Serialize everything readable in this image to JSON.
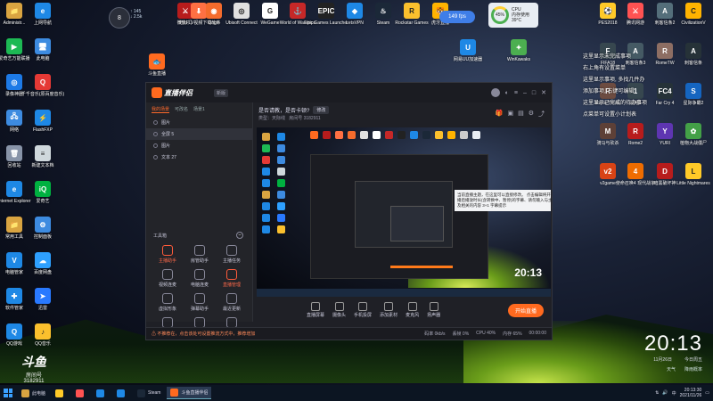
{
  "desktop": {
    "left_icons": [
      {
        "label": "Administr...",
        "color": "#d9a441",
        "glyph": "📁"
      },
      {
        "label": "上网导航",
        "color": "#1e88e5",
        "glyph": "e"
      },
      {
        "label": "爱奇艺万能联播",
        "color": "#1db954",
        "glyph": "▶"
      },
      {
        "label": "此电脑",
        "color": "#3d8be0",
        "glyph": "🖥"
      },
      {
        "label": "录像神器",
        "color": "#1d7ae6",
        "glyph": "◎"
      },
      {
        "label": "千千音乐(原百度音乐)",
        "color": "#e53935",
        "glyph": "Q"
      },
      {
        "label": "网络",
        "color": "#3d8be0",
        "glyph": "🖧"
      },
      {
        "label": "FlashFXP",
        "color": "#1e88e5",
        "glyph": "⚡"
      },
      {
        "label": "回收站",
        "color": "#8894a8",
        "glyph": "🗑"
      },
      {
        "label": "新建文本档",
        "color": "#cfd8dc",
        "glyph": "≡"
      },
      {
        "label": "Internet Explorer",
        "color": "#1e88e5",
        "glyph": "e"
      },
      {
        "label": "爱奇艺",
        "color": "#00b140",
        "glyph": "iQ"
      },
      {
        "label": "常用工具",
        "color": "#d9a441",
        "glyph": "📁"
      },
      {
        "label": "控制面板",
        "color": "#3d8be0",
        "glyph": "⚙"
      },
      {
        "label": "电脑管家",
        "color": "#1e88e5",
        "glyph": "V"
      },
      {
        "label": "百度网盘",
        "color": "#2ea0ff",
        "glyph": "☁"
      },
      {
        "label": "软件管家",
        "color": "#1e88e5",
        "glyph": "✚"
      },
      {
        "label": "迅雷",
        "color": "#2979ff",
        "glyph": "➤"
      },
      {
        "label": "QQ游戏",
        "color": "#1e88e5",
        "glyph": "Q"
      },
      {
        "label": "QQ音乐",
        "color": "#fbc02d",
        "glyph": "♪"
      }
    ],
    "top_icons": [
      {
        "label": "斗鱼直播",
        "color": "#ff6a1f",
        "glyph": "🐟"
      },
      {
        "label": "地狱门",
        "color": "#b71c1c",
        "glyph": "⚔"
      },
      {
        "label": "微软FLV视频下载软件",
        "color": "#ff7043",
        "glyph": "⬇"
      },
      {
        "label": "Origin",
        "color": "#f56c2d",
        "glyph": "◉"
      },
      {
        "label": "Ubisoft Connect",
        "color": "#e0e0e0",
        "glyph": "◎"
      },
      {
        "label": "WeGame",
        "color": "#ffffff",
        "glyph": "G"
      },
      {
        "label": "World of Warships",
        "color": "#c62828",
        "glyph": "⚓"
      },
      {
        "label": "Epic Games Launcher",
        "color": "#222222",
        "glyph": "EPIC"
      },
      {
        "label": "LetsVPN",
        "color": "#1e88e5",
        "glyph": "◆"
      },
      {
        "label": "Steam",
        "color": "#1b2838",
        "glyph": "♨"
      },
      {
        "label": "Rockstar Games",
        "color": "#fbc02d",
        "glyph": "R"
      },
      {
        "label": "虎牙直播",
        "color": "#ffb300",
        "glyph": "🐯"
      },
      {
        "label": "网易UU加速器",
        "color": "#1e88e5",
        "glyph": "U"
      },
      {
        "label": "WinKawaks",
        "color": "#4caf50",
        "glyph": "✦"
      }
    ],
    "right_icons": [
      {
        "label": "PES2018",
        "color": "#ffca28",
        "glyph": "⚽"
      },
      {
        "label": "腾讯网游",
        "color": "#ff5252",
        "glyph": "⚔"
      },
      {
        "label": "刺客信条2",
        "color": "#546e7a",
        "glyph": "A"
      },
      {
        "label": "CivilizationV",
        "color": "#ffb300",
        "glyph": "C"
      },
      {
        "label": "FIFA18",
        "color": "#37474f",
        "glyph": "F"
      },
      {
        "label": "刺客信条3",
        "color": "#455a64",
        "glyph": "A"
      },
      {
        "label": "RomeTW",
        "color": "#8d6e63",
        "glyph": "R"
      },
      {
        "label": "刺客信条",
        "color": "#263238",
        "glyph": "A"
      },
      {
        "label": "RomeTW-BI",
        "color": "#6d4c41",
        "glyph": "R"
      },
      {
        "label": "战地1",
        "color": "#37474f",
        "glyph": "1"
      },
      {
        "label": "Far Cry 4",
        "color": "#263238",
        "glyph": "FC4"
      },
      {
        "label": "星际争霸2",
        "color": "#1565c0",
        "glyph": "S"
      },
      {
        "label": "骑马与砍杀",
        "color": "#5d4037",
        "glyph": "M"
      },
      {
        "label": "Rome2",
        "color": "#b71c1c",
        "glyph": "R"
      },
      {
        "label": "YURI",
        "color": "#5e35b1",
        "glyph": "Y"
      },
      {
        "label": "植物大战僵尸",
        "color": "#43a047",
        "glyph": "✿"
      },
      {
        "label": "v2game",
        "color": "#d84315",
        "glyph": "v2"
      },
      {
        "label": "使命召唤4 现代战争",
        "color": "#ef6c00",
        "glyph": "4"
      },
      {
        "label": "暗黑破坏神",
        "color": "#b71c1c",
        "glyph": "D"
      },
      {
        "label": "Little Nightmares",
        "color": "#ffca28",
        "glyph": "L"
      }
    ],
    "notes": [
      "这里显示未完成事项",
      "右上角有设置菜单",
      "这里显示事项, 多找几件办",
      "添加事项, 右键可编辑",
      "这里显示已完成的待办事项",
      "点菜单可设置小计划表"
    ]
  },
  "widgets": {
    "ball_value": "8",
    "net_up": "↑ 145",
    "net_down": "↓ 2.5k",
    "fps": "149",
    "fps_unit": "fps",
    "cpu_label": "CPU",
    "cpu_value": "45%",
    "cpu_sub": "内存使用",
    "cpu_temp": "39°C"
  },
  "app": {
    "name": "直播伴侣",
    "version": "新版",
    "tabs": [
      "我的场景",
      "可改名",
      "场景1"
    ],
    "sources": [
      {
        "label": "图片",
        "selected": false
      },
      {
        "label": "全屏 5",
        "selected": true
      },
      {
        "label": "图片",
        "selected": false
      },
      {
        "label": "文本 27",
        "selected": false
      }
    ],
    "tools_title": "工具箱",
    "tools": [
      {
        "label": "主播助手",
        "red": true
      },
      {
        "label": "房管助手",
        "red": false
      },
      {
        "label": "主播任务",
        "red": false
      },
      {
        "label": "视频连麦",
        "red": false
      },
      {
        "label": "电脑连麦",
        "red": false
      },
      {
        "label": "直播管理",
        "red": true
      },
      {
        "label": "虚拟形象",
        "red": false
      },
      {
        "label": "弹幕助手",
        "red": false
      },
      {
        "label": "最近更新",
        "red": false
      },
      {
        "label": "小窗口",
        "red": false
      },
      {
        "label": "更多工具",
        "red": false
      },
      {
        "label": "设置",
        "red": false
      }
    ],
    "stream_title": "是否请教，是否卡顿?",
    "stream_title_btn": "修改",
    "stream_category": "类型：天际线",
    "stream_sub": "房间号",
    "stream_room": "3182911",
    "preview_clock": "20:13",
    "preview_tooltip": "当前直播主题，在这里可以直接修改。 点击编辑将开始直播后播放时长(含转换中、暂停)的字幕、请勿输入与主播及相关的内容 3+1 字幕提示",
    "bottom_tools": [
      "直播屏幕",
      "摄像头",
      "手机投屏",
      "添加素材",
      "麦克风",
      "扬声器"
    ],
    "start_label": "开始直播",
    "status_warn": "⚠ 不推荐在，点击该处可设置推流方式中，推荐增加",
    "status_right": [
      "码率 0kb/s",
      "丢帧 0%",
      "CPU 40%",
      "内存 65%",
      "00:00:00"
    ]
  },
  "overlay_logo": {
    "big": "斗鱼",
    "sub": "房间号",
    "room": "3182911"
  },
  "clock": {
    "time": "20:13",
    "date": "11月26日",
    "weekday": "今日周五",
    "weather_left": "天气",
    "weather_right": "降雨概率"
  },
  "taskbar": {
    "items": [
      {
        "label": "此电脑",
        "color": "#d9a441",
        "active": false
      },
      {
        "label": "",
        "color": "#ffca28",
        "active": false
      },
      {
        "label": "",
        "color": "#ff5252",
        "active": false
      },
      {
        "label": "",
        "color": "#1e88e5",
        "active": false
      },
      {
        "label": "",
        "color": "#1e88e5",
        "active": false
      },
      {
        "label": "Steam",
        "color": "#1b2838",
        "active": false
      },
      {
        "label": "斗鱼直播伴侣",
        "color": "#ff6a1f",
        "active": true
      }
    ],
    "tray_time": "20:13:30",
    "tray_date": "2021/11/26",
    "tray_lang": "中"
  }
}
